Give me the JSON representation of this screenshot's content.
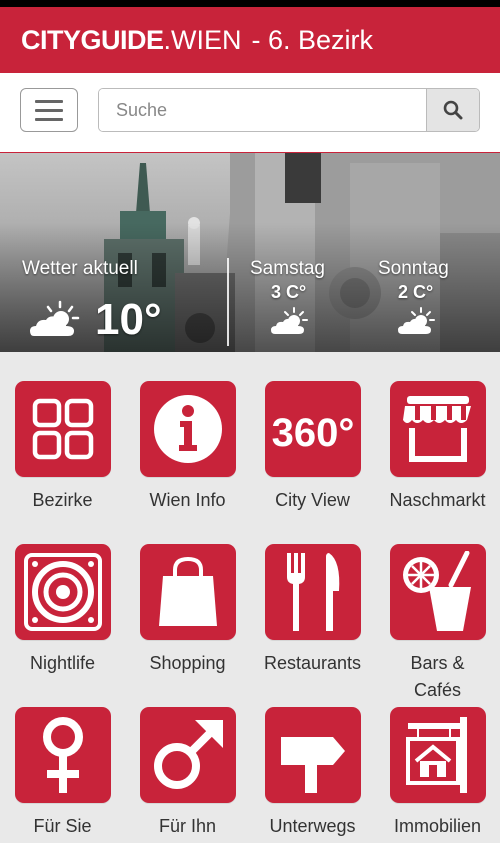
{
  "header": {
    "brand_bold": "CITYGUIDE",
    "brand_light": ".WIEN",
    "subtitle": "- 6. Bezirk",
    "accent_color": "#c8233a"
  },
  "search": {
    "placeholder": "Suche",
    "menu_icon": "hamburger-icon",
    "search_icon": "magnifier-icon"
  },
  "weather": {
    "current_label": "Wetter aktuell",
    "current_temp": "10°",
    "current_icon": "partly-cloudy-icon",
    "forecast": [
      {
        "day": "Samstag",
        "temp": "3 C°",
        "icon": "partly-cloudy-icon"
      },
      {
        "day": "Sonntag",
        "temp": "2 C°",
        "icon": "partly-cloudy-icon"
      }
    ]
  },
  "tiles": [
    {
      "label": "Bezirke",
      "icon": "grid-icon"
    },
    {
      "label": "Wien Info",
      "icon": "info-icon"
    },
    {
      "label": "City View",
      "icon": "360-icon"
    },
    {
      "label": "Naschmarkt",
      "icon": "market-stall-icon"
    },
    {
      "label": "Nightlife",
      "icon": "speaker-icon"
    },
    {
      "label": "Shopping",
      "icon": "shopping-bag-icon"
    },
    {
      "label": "Restaurants",
      "icon": "cutlery-icon"
    },
    {
      "label": "Bars &\nCafés",
      "label_line1": "Bars &",
      "label_line2": "Cafés",
      "icon": "drink-icon"
    },
    {
      "label": "Für Sie",
      "icon": "female-icon"
    },
    {
      "label": "Für Ihn",
      "icon": "male-icon"
    },
    {
      "label": "Unterwegs",
      "icon": "signpost-icon"
    },
    {
      "label": "Immobilien",
      "icon": "house-sign-icon"
    }
  ]
}
